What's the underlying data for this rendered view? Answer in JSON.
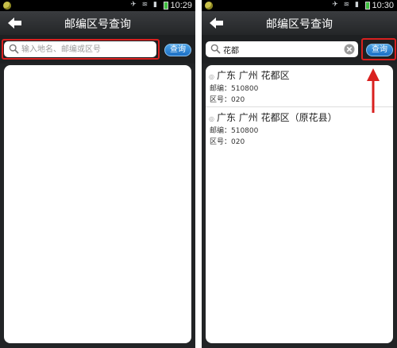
{
  "left": {
    "status_time": "10:29",
    "title": "邮编区号查询",
    "search_placeholder": "输入地名、邮编或区号",
    "query_button": "查询"
  },
  "right": {
    "status_time": "10:30",
    "title": "邮编区号查询",
    "search_value": "花都",
    "query_button": "查询",
    "results": [
      {
        "title": "广东 广州 花都区",
        "postcode": "邮编：510800",
        "areacode": "区号：020"
      },
      {
        "title": "广东 广州 花都区（原花县）",
        "postcode": "邮编：510800",
        "areacode": "区号：020"
      }
    ]
  },
  "colors": {
    "highlight": "#d9201f",
    "button": "#2a7fd0",
    "title_bar": "#2e3033"
  },
  "icons": [
    "back-arrow-icon",
    "search-icon",
    "clear-icon",
    "wifi-icon",
    "signal-icon",
    "battery-icon",
    "app-icon"
  ]
}
